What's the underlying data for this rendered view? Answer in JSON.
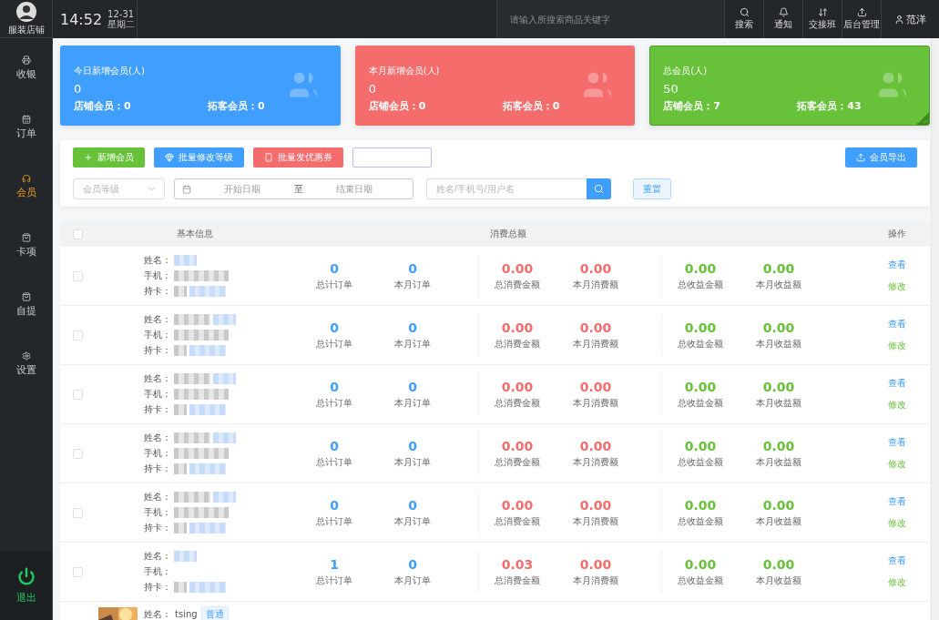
{
  "sidebar": {
    "store": "服装店铺",
    "items": [
      {
        "label": "收银",
        "selected": false
      },
      {
        "label": "订单",
        "selected": false
      },
      {
        "label": "会员",
        "selected": true
      },
      {
        "label": "卡项",
        "selected": false
      },
      {
        "label": "自提",
        "selected": false
      },
      {
        "label": "设置",
        "selected": false
      }
    ],
    "logout": "退出"
  },
  "topbar": {
    "time": "14:52",
    "date": "12-31",
    "weekday": "星期二",
    "search_placeholder": "请输入所搜索商品关键字",
    "actions": [
      {
        "label": "搜索"
      },
      {
        "label": "通知"
      },
      {
        "label": "交接班"
      },
      {
        "label": "后台管理"
      }
    ],
    "user": "范洋"
  },
  "stat_cards": [
    {
      "title": "今日新增会员(人)",
      "value": "0",
      "store_label": "店铺会员：",
      "store_value": "0",
      "expand_label": "拓客会员：",
      "expand_value": "0",
      "color": "#409eff",
      "selected": false
    },
    {
      "title": "本月新增会员(人)",
      "value": "0",
      "store_label": "店铺会员：",
      "store_value": "0",
      "expand_label": "拓客会员：",
      "expand_value": "0",
      "color": "#f56c6c",
      "selected": false
    },
    {
      "title": "总会员(人)",
      "value": "50",
      "store_label": "店铺会员：",
      "store_value": "7",
      "expand_label": "拓客会员：",
      "expand_value": "43",
      "color": "#67c23a",
      "selected": true
    }
  ],
  "toolbar": {
    "buttons": [
      {
        "label": "新增会员",
        "color": "#67c23a"
      },
      {
        "label": "批量修改等级",
        "color": "#409eff"
      },
      {
        "label": "批量发优惠券",
        "color": "#f56c6c"
      }
    ],
    "export": "会员导出"
  },
  "filters": {
    "level_placeholder": "会员等级",
    "start_placeholder": "开始日期",
    "separator": "至",
    "end_placeholder": "结束日期",
    "search_placeholder": "姓名/手机号/用户名",
    "reset": "重置"
  },
  "table": {
    "columns": [
      "基本信息",
      "消费总额",
      "操作"
    ],
    "header_checked": false,
    "rows": [
      {
        "kind": "full",
        "checked": false,
        "labels": [
          "姓名：",
          "手机：",
          "持卡："
        ],
        "name_blurred": false,
        "tag_blurred": true,
        "phone_blurred": true,
        "stats": [
          {
            "value": "0",
            "caption": "总计订单"
          },
          {
            "value": "0",
            "caption": "本月订单"
          },
          {
            "value": "0.00",
            "caption": "总消费金额"
          },
          {
            "value": "0.00",
            "caption": "本月消费额"
          },
          {
            "value": "0.00",
            "caption": "总收益金额"
          },
          {
            "value": "0.00",
            "caption": "本月收益额"
          }
        ],
        "view": "查看",
        "edit": "修改"
      },
      {
        "kind": "full",
        "checked": false,
        "labels": [
          "姓名：",
          "手机：",
          "持卡："
        ],
        "name_blurred": true,
        "tag_blurred": true,
        "phone_blurred": true,
        "stats": [
          {
            "value": "0",
            "caption": "总计订单"
          },
          {
            "value": "0",
            "caption": "本月订单"
          },
          {
            "value": "0.00",
            "caption": "总消费金额"
          },
          {
            "value": "0.00",
            "caption": "本月消费额"
          },
          {
            "value": "0.00",
            "caption": "总收益金额"
          },
          {
            "value": "0.00",
            "caption": "本月收益额"
          }
        ],
        "view": "查看",
        "edit": "修改"
      },
      {
        "kind": "full",
        "checked": false,
        "labels": [
          "姓名：",
          "手机：",
          "持卡："
        ],
        "name_blurred": true,
        "tag_blurred": true,
        "phone_blurred": true,
        "stats": [
          {
            "value": "0",
            "caption": "总计订单"
          },
          {
            "value": "0",
            "caption": "本月订单"
          },
          {
            "value": "0.00",
            "caption": "总消费金额"
          },
          {
            "value": "0.00",
            "caption": "本月消费额"
          },
          {
            "value": "0.00",
            "caption": "总收益金额"
          },
          {
            "value": "0.00",
            "caption": "本月收益额"
          }
        ],
        "view": "查看",
        "edit": "修改"
      },
      {
        "kind": "full",
        "checked": false,
        "labels": [
          "姓名：",
          "手机：",
          "持卡："
        ],
        "name_blurred": true,
        "tag_blurred": true,
        "phone_blurred": true,
        "stats": [
          {
            "value": "0",
            "caption": "总计订单"
          },
          {
            "value": "0",
            "caption": "本月订单"
          },
          {
            "value": "0.00",
            "caption": "总消费金额"
          },
          {
            "value": "0.00",
            "caption": "本月消费额"
          },
          {
            "value": "0.00",
            "caption": "总收益金额"
          },
          {
            "value": "0.00",
            "caption": "本月收益额"
          }
        ],
        "view": "查看",
        "edit": "修改"
      },
      {
        "kind": "full",
        "checked": false,
        "labels": [
          "姓名：",
          "手机：",
          "持卡："
        ],
        "name_blurred": true,
        "tag_blurred": true,
        "phone_blurred": true,
        "stats": [
          {
            "value": "0",
            "caption": "总计订单"
          },
          {
            "value": "0",
            "caption": "本月订单"
          },
          {
            "value": "0.00",
            "caption": "总消费金额"
          },
          {
            "value": "0.00",
            "caption": "本月消费额"
          },
          {
            "value": "0.00",
            "caption": "总收益金额"
          },
          {
            "value": "0.00",
            "caption": "本月收益额"
          }
        ],
        "view": "查看",
        "edit": "修改"
      },
      {
        "kind": "full",
        "checked": false,
        "labels": [
          "姓名：",
          "手机：",
          "持卡："
        ],
        "name_blurred": false,
        "tag_blurred": true,
        "phone_blurred": false,
        "stats": [
          {
            "value": "1",
            "caption": "总计订单"
          },
          {
            "value": "0",
            "caption": "本月订单"
          },
          {
            "value": "0.03",
            "caption": "总消费金额"
          },
          {
            "value": "0.00",
            "caption": "本月消费额"
          },
          {
            "value": "0.00",
            "caption": "总收益金额"
          },
          {
            "value": "0.00",
            "caption": "本月收益额"
          }
        ],
        "view": "查看",
        "edit": "修改"
      },
      {
        "kind": "partial",
        "labels": [
          "姓名："
        ],
        "name": "tsing",
        "tag": "普通"
      }
    ]
  }
}
